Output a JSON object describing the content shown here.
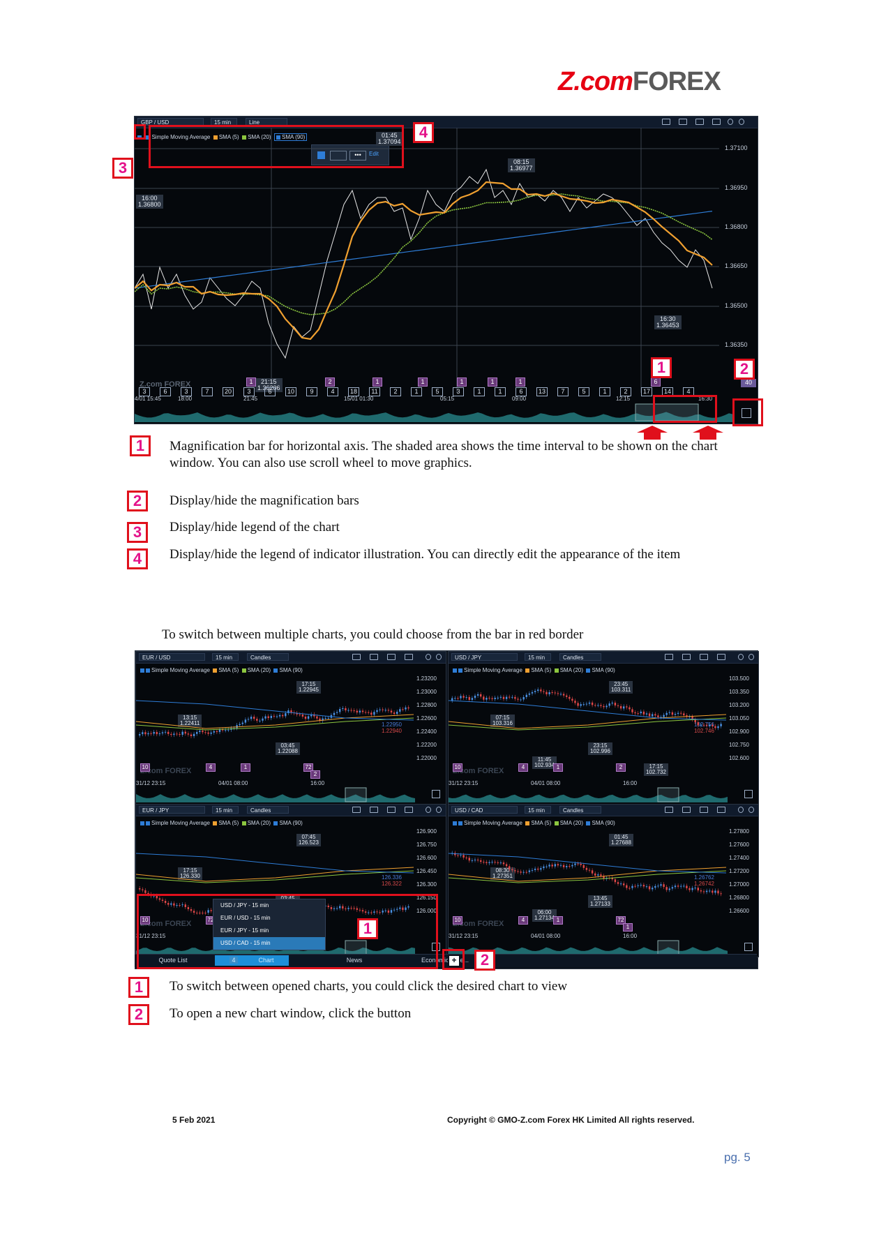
{
  "logo": {
    "z_part": "Z.com",
    "forex_part": "FOREX"
  },
  "chart1": {
    "pair": "GBP / USD",
    "interval": "15 min",
    "type": "Line",
    "legend": {
      "indicator": "Simple Moving Average",
      "sma5": "SMA (5)",
      "sma20": "SMA (20)",
      "sma90": "SMA (90)",
      "edit": "Edit"
    },
    "y_ticks": [
      "1.37100",
      "1.36950",
      "1.36800",
      "1.36650",
      "1.36500",
      "1.36350"
    ],
    "x_ticks": [
      "4/01 15:45",
      "18:00",
      "21:45",
      "15/01 01:30",
      "05:15",
      "09:00",
      "12:15",
      "16:30"
    ],
    "bubbles": {
      "b1": "01:45\n1.37094",
      "b2": "08:15\n1.36977",
      "b3": "16:00\n1.36800",
      "b4": "16:30\n1.36453",
      "b5": "21:15\n1.36206"
    },
    "events": [
      "3",
      "6",
      "3",
      "7",
      "20",
      "3",
      "6",
      "10",
      "9",
      "4",
      "18",
      "11",
      "2",
      "1",
      "5",
      "3",
      "1",
      "1",
      "6",
      "13",
      "7",
      "5",
      "1",
      "2",
      "17",
      "14",
      "4"
    ],
    "events_top": [
      "1",
      "2",
      "1",
      "1",
      "1",
      "1",
      "1",
      "6"
    ],
    "watermark": "Z.com FOREX",
    "corner_value": "40"
  },
  "badges": {
    "b1": "1",
    "b2": "2",
    "b3": "3",
    "b4": "4"
  },
  "descriptions": {
    "d1": "Magnification bar for horizontal axis. The shaded area shows the time interval to be shown on the chart window. You can also use scroll wheel to move graphics.",
    "d2": "Display/hide the magnification bars",
    "d3": "Display/hide legend of the chart",
    "d4": "Display/hide the legend of indicator illustration. You can directly edit the appearance of the item"
  },
  "switch_intro": "To switch between multiple charts, you could choose from the bar in red border",
  "grid_charts": [
    {
      "pair": "EUR / USD",
      "interval": "15 min",
      "type": "Candles",
      "y_ticks": [
        "1.23200",
        "1.23000",
        "1.22800",
        "1.22600",
        "1.22400",
        "1.22200",
        "1.22000"
      ],
      "x_ticks": [
        "31/12 23:15",
        "04/01 08:00",
        "16:00"
      ],
      "bubbles": [
        "17:15\n1.22945",
        "13:15\n1.22411",
        "03:45\n1.22088"
      ],
      "last": [
        "1.22950",
        "1.22940"
      ],
      "events": [
        "10",
        "4",
        "1",
        "72",
        "2"
      ]
    },
    {
      "pair": "USD / JPY",
      "interval": "15 min",
      "type": "Candles",
      "y_ticks": [
        "103.500",
        "103.350",
        "103.200",
        "103.050",
        "102.900",
        "102.750",
        "102.600"
      ],
      "x_ticks": [
        "31/12 23:15",
        "04/01 08:00",
        "16:00"
      ],
      "bubbles": [
        "23:45\n103.311",
        "07:15\n103.316",
        "23:15\n102.996",
        "11:45\n102.934",
        "17:15\n102.732"
      ],
      "last": [
        "102.756",
        "102.746"
      ],
      "events": [
        "10",
        "4",
        "1",
        "2"
      ]
    },
    {
      "pair": "EUR / JPY",
      "interval": "15 min",
      "type": "Candles",
      "y_ticks": [
        "126.900",
        "126.750",
        "126.600",
        "126.450",
        "126.300",
        "126.150",
        "126.000"
      ],
      "x_ticks": [
        "31/12 23:15"
      ],
      "bubbles": [
        "07:45\n126.523",
        "17:15\n126.330",
        "03:45\n126.080"
      ],
      "last": [
        "126.336",
        "126.322"
      ],
      "events": [
        "10",
        "72",
        "2"
      ]
    },
    {
      "pair": "USD / CAD",
      "interval": "15 min",
      "type": "Candles",
      "y_ticks": [
        "1.27800",
        "1.27600",
        "1.27400",
        "1.27200",
        "1.27000",
        "1.26800",
        "1.26600"
      ],
      "x_ticks": [
        "31/12 23:15",
        "04/01 08:00",
        "16:00"
      ],
      "bubbles": [
        "01:45\n1.27688",
        "08:30\n1.27351",
        "13:45\n1.27133",
        "06:00\n1.27134"
      ],
      "last": [
        "1.26762",
        "1.26742"
      ],
      "events": [
        "10",
        "4",
        "1",
        "72",
        "1"
      ]
    }
  ],
  "legend_common": {
    "indicator": "Simple Moving Average",
    "sma5": "SMA (5)",
    "sma20": "SMA (20)",
    "sma90": "SMA (90)"
  },
  "chart_menu": [
    "USD / JPY - 15 min",
    "EUR / USD - 15 min",
    "EUR / JPY - 15 min",
    "USD / CAD - 15 min"
  ],
  "tabs": {
    "quote": "Quote List",
    "count": "4",
    "chart": "Chart",
    "news": "News",
    "calendar": "Economic Cale..."
  },
  "bottom_notes": {
    "n1": "To switch between opened charts, you could click the desired chart to view",
    "n2": "To open a new chart window, click the button"
  },
  "footer": {
    "date": "5 Feb 2021",
    "copyright": "Copyright © GMO-Z.com Forex HK Limited All rights reserved.",
    "page": "pg.  5"
  },
  "colors": {
    "sma5": "#f0a030",
    "sma20": "#8cc63f",
    "sma90": "#2e7dd7",
    "price": "#e8e8e8",
    "red": "#e0101c",
    "badge_text": "#e4128a"
  }
}
